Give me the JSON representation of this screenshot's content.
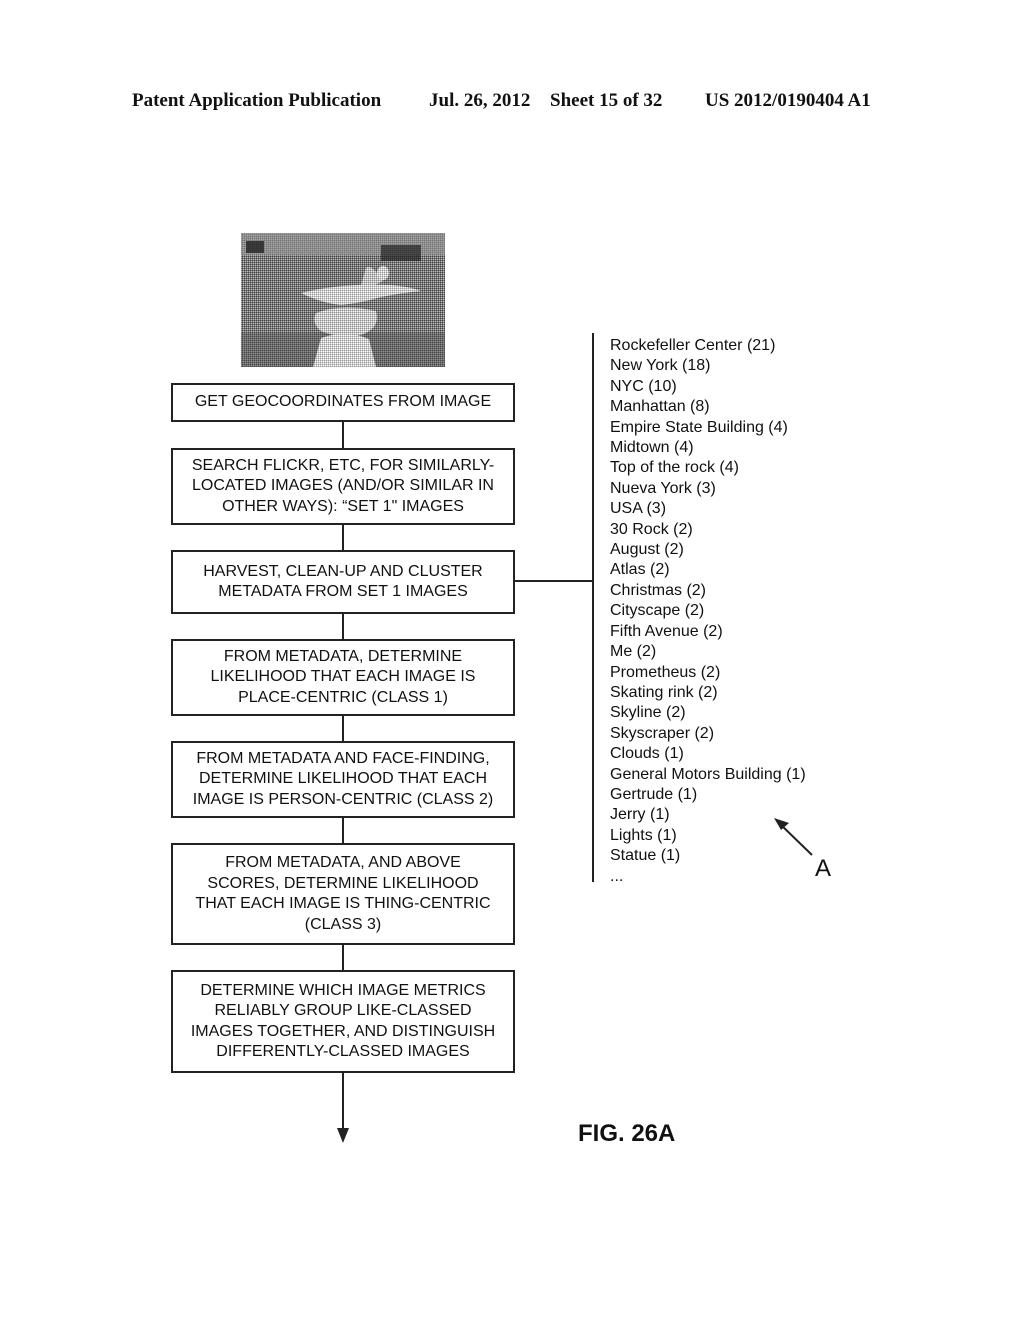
{
  "header": {
    "publication": "Patent Application Publication",
    "date": "Jul. 26, 2012",
    "sheet": "Sheet 15 of 32",
    "number": "US 2012/0190404 A1"
  },
  "photo": {
    "description": "halftone photo of Prometheus statue at Rockefeller Center",
    "icon": "photo-image"
  },
  "flowchart": {
    "steps": [
      {
        "lines": [
          "GET GEOCOORDINATES FROM IMAGE"
        ]
      },
      {
        "lines": [
          "SEARCH FLICKR, ETC, FOR SIMILARLY-",
          "LOCATED IMAGES (AND/OR SIMILAR IN",
          "OTHER WAYS): “SET 1\" IMAGES"
        ]
      },
      {
        "lines": [
          "HARVEST, CLEAN-UP AND CLUSTER",
          "METADATA FROM SET 1 IMAGES"
        ]
      },
      {
        "lines": [
          "FROM METADATA, DETERMINE",
          "LIKELIHOOD THAT EACH IMAGE IS",
          "PLACE-CENTRIC (CLASS 1)"
        ]
      },
      {
        "lines": [
          "FROM METADATA AND FACE-FINDING,",
          "DETERMINE LIKELIHOOD THAT EACH",
          "IMAGE IS PERSON-CENTRIC (CLASS 2)"
        ]
      },
      {
        "lines": [
          "FROM METADATA, AND ABOVE",
          "SCORES, DETERMINE LIKELIHOOD",
          "THAT EACH IMAGE IS THING-CENTRIC",
          "(CLASS 3)"
        ]
      },
      {
        "lines": [
          "DETERMINE WHICH IMAGE METRICS",
          "RELIABLY GROUP LIKE-CLASSED",
          "IMAGES TOGETHER, AND DISTINGUISH",
          "DIFFERENTLY-CLASSED IMAGES"
        ]
      }
    ]
  },
  "metadata_list": {
    "items": [
      "Rockefeller Center (21)",
      "New York (18)",
      "NYC (10)",
      "Manhattan (8)",
      "Empire State Building (4)",
      "Midtown (4)",
      "Top of the rock (4)",
      "Nueva York (3)",
      "USA (3)",
      "30 Rock (2)",
      "August (2)",
      "Atlas (2)",
      "Christmas (2)",
      "Cityscape (2)",
      "Fifth Avenue (2)",
      "Me (2)",
      "Prometheus (2)",
      "Skating rink (2)",
      "Skyline (2)",
      "Skyscraper (2)",
      "Clouds (1)",
      "General Motors Building (1)",
      "Gertrude (1)",
      "Jerry (1)",
      "Lights (1)",
      "Statue (1)",
      "..."
    ]
  },
  "annotation": {
    "label": "A"
  },
  "figure": {
    "caption": "FIG. 26A"
  }
}
